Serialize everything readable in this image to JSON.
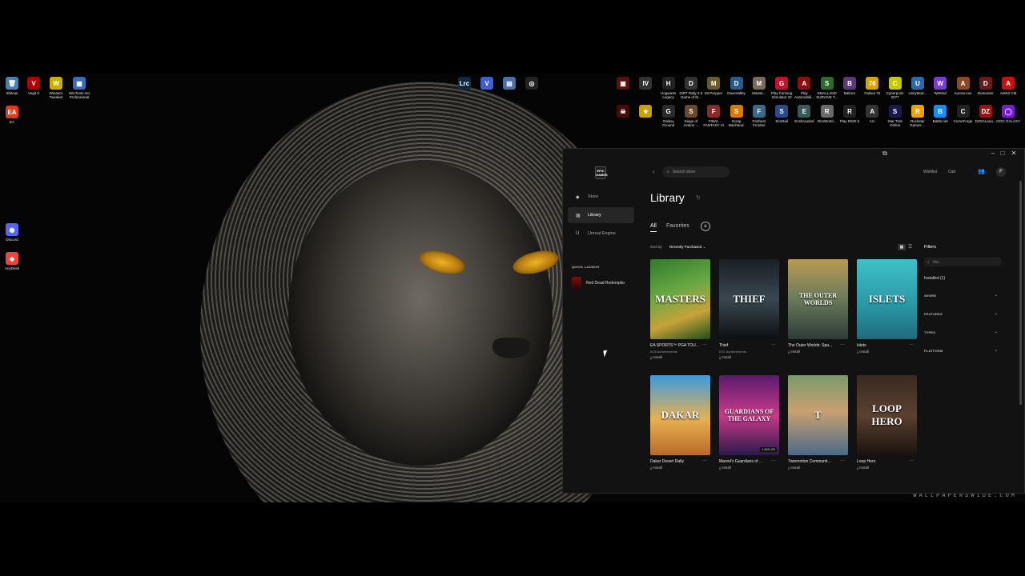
{
  "desktop": {
    "icons_left": [
      {
        "label": "Shitcan",
        "glyph": "🗑",
        "color": "#4a7fb5"
      },
      {
        "label": "Vegit 9",
        "glyph": "V",
        "color": "#b00000"
      },
      {
        "label": "Winaero Tweaker",
        "glyph": "W",
        "color": "#c9b000"
      },
      {
        "label": "WinTools.net Professional",
        "glyph": "▦",
        "color": "#3a6bb8"
      },
      {
        "label": "EA",
        "glyph": "EA",
        "color": "#e03a1e"
      },
      {
        "label": "Discord",
        "glyph": "◉",
        "color": "#5865f2"
      },
      {
        "label": "AnyDesk",
        "glyph": "◆",
        "color": "#ef443b"
      }
    ],
    "icons_top_center": [
      {
        "label": "",
        "glyph": "Lrc",
        "color": "#0d2a45"
      },
      {
        "label": "",
        "glyph": "V",
        "color": "#3f5fd0"
      },
      {
        "label": "",
        "glyph": "▤",
        "color": "#4b6ea8"
      },
      {
        "label": "",
        "glyph": "◎",
        "color": "#222"
      }
    ],
    "icons_top_right_row1": [
      {
        "label": "",
        "glyph": "▣",
        "color": "#5a1010"
      },
      {
        "label": "",
        "glyph": "IV",
        "color": "#333"
      },
      {
        "label": "Hogwarts Legacy",
        "glyph": "H",
        "color": "#222"
      },
      {
        "label": "DiRT Rally 2.0 Game of th...",
        "glyph": "D",
        "color": "#333"
      },
      {
        "label": "Mr.Prepper",
        "glyph": "M",
        "color": "#6a5a2a"
      },
      {
        "label": "DaveValley",
        "glyph": "D",
        "color": "#2a5a8a"
      },
      {
        "label": "Mansti...",
        "glyph": "M",
        "color": "#7a6a5a"
      },
      {
        "label": "Play Farming Simulator 22",
        "glyph": "G",
        "color": "#c8102e"
      },
      {
        "label": "Play Automobili...",
        "glyph": "A",
        "color": "#8a1010"
      },
      {
        "label": "SMALLAND SURVIVE T...",
        "glyph": "S",
        "color": "#2e6a2e"
      },
      {
        "label": "Balrum",
        "glyph": "B",
        "color": "#5a3a7a"
      },
      {
        "label": "Fallout 76",
        "glyph": "76",
        "color": "#d8a400"
      },
      {
        "label": "Cyberpunk 2077",
        "glyph": "C",
        "color": "#c8c800"
      },
      {
        "label": "UnityMod...",
        "glyph": "U",
        "color": "#2a6aa8"
      },
      {
        "label": "WeMod",
        "glyph": "W",
        "color": "#7a3ad8"
      },
      {
        "label": "Aurora.exe",
        "glyph": "A",
        "color": "#8a4a2a"
      },
      {
        "label": "Demonter",
        "glyph": "D",
        "color": "#6a1a1a"
      },
      {
        "label": "AMS2 CM",
        "glyph": "A",
        "color": "#c81010"
      }
    ],
    "icons_top_right_row2": [
      {
        "label": "",
        "glyph": "☠",
        "color": "#4a0a0a"
      },
      {
        "label": "",
        "glyph": "★",
        "color": "#c8a000"
      },
      {
        "label": "Galaxy Ground",
        "glyph": "G",
        "color": "#2a2a2a"
      },
      {
        "label": "Siege of Avalon ...",
        "glyph": "S",
        "color": "#6a4a2a"
      },
      {
        "label": "FINAL FANTASY VI",
        "glyph": "F",
        "color": "#8a2a2a"
      },
      {
        "label": "Scrap Mechanic",
        "glyph": "S",
        "color": "#d87a00"
      },
      {
        "label": "Farthest Frontier",
        "glyph": "F",
        "color": "#3a6a8a"
      },
      {
        "label": "SimRail",
        "glyph": "S",
        "color": "#2a4a8a"
      },
      {
        "label": "Enshrouded",
        "glyph": "E",
        "color": "#3a5a5a"
      },
      {
        "label": "RimWorld...",
        "glyph": "R",
        "color": "#6a6a6a"
      },
      {
        "label": "Play RIDE 5",
        "glyph": "R",
        "color": "#222"
      },
      {
        "label": "Arc",
        "glyph": "A",
        "color": "#333"
      },
      {
        "label": "Star Trek Online",
        "glyph": "S",
        "color": "#1a1a4a"
      },
      {
        "label": "Rockstar Games ...",
        "glyph": "R",
        "color": "#f0a000"
      },
      {
        "label": "Battle.net",
        "glyph": "B",
        "color": "#148eff"
      },
      {
        "label": "CurseForge",
        "glyph": "C",
        "color": "#222"
      },
      {
        "label": "DZSALaun...",
        "glyph": "DZ",
        "color": "#a01010"
      },
      {
        "label": "GOG GALAXY",
        "glyph": "◯",
        "color": "#7a1ad8"
      }
    ],
    "wallpaper_watermark": "WALLPAPERSWIDE.COM"
  },
  "window": {
    "buttons": {
      "minimize": "–",
      "maximize": "□",
      "close": "✕",
      "overlay": "⧉"
    }
  },
  "sidebar": {
    "logo_text": "EPIC GAMES",
    "items": [
      {
        "label": "Store",
        "icon": "tag-icon",
        "glyph": "◆"
      },
      {
        "label": "Library",
        "icon": "grid-icon",
        "glyph": "▦"
      },
      {
        "label": "Unreal Engine",
        "icon": "unreal-icon",
        "glyph": "U"
      }
    ],
    "quick_launch_heading": "QUICK LAUNCH",
    "quick_launch_item": "Red Dead Redemptio"
  },
  "header": {
    "back": "‹",
    "search_placeholder": "Search store",
    "wishlist": "Wishlist",
    "cart": "Cart",
    "avatar_initial": "F"
  },
  "library": {
    "title": "Library",
    "tabs": {
      "all": "All",
      "favorites": "Favorites",
      "add": "+"
    },
    "sort_label": "Sort by:",
    "sort_value": "Recently Purchased ⌄",
    "games": [
      {
        "title": "EA SPORTS™ PGA TOU...",
        "meta": "0/16 Achievements",
        "action": "Install",
        "art_text": "MASTERS",
        "bg": "linear-gradient(160deg,#2f7a2a 0%,#6aa844 40%,#c7a23a 70%,#1f4e1a 100%)",
        "badge": ""
      },
      {
        "title": "Thief",
        "meta": "0/37 Achievements",
        "action": "Install",
        "art_text": "THIEF",
        "bg": "linear-gradient(180deg,#1a1f24 0%,#3a4750 50%,#0d1013 100%)",
        "badge": ""
      },
      {
        "title": "The Outer Worlds: Spa...",
        "meta": "",
        "action": "Install",
        "art_text": "THE OUTER WORLDS",
        "bg": "linear-gradient(180deg,#b79a55 0%,#6a7a5a 50%,#2e3a3a 100%)",
        "badge": ""
      },
      {
        "title": "Islets",
        "meta": "",
        "action": "Install",
        "art_text": "ISLETS",
        "bg": "linear-gradient(180deg,#3fc0c8 0%,#2a9aa8 55%,#1f6a7a 100%)",
        "badge": ""
      },
      {
        "title": "Dakar Desert Rally",
        "meta": "",
        "action": "Install",
        "art_text": "DAKAR",
        "bg": "linear-gradient(180deg,#3a9ae0 0%,#e8b050 55%,#b86a2a 100%)",
        "badge": ""
      },
      {
        "title": "Marvel's Guardians of ...",
        "meta": "",
        "action": "Install",
        "art_text": "GUARDIANS OF THE GALAXY",
        "bg": "linear-gradient(180deg,#5a1a6a 0%,#c83a8a 50%,#2a1a4a 100%)",
        "badge": "1 ADD-ON"
      },
      {
        "title": "Twinmotion Communit...",
        "meta": "",
        "action": "Install",
        "art_text": "T",
        "bg": "linear-gradient(180deg,#7a9a6a 0%,#c8a070 45%,#4a6a8a 100%)",
        "badge": ""
      },
      {
        "title": "Loop Hero",
        "meta": "",
        "action": "Install",
        "art_text": "LOOP HERO",
        "bg": "linear-gradient(180deg,#3a2a20 0%,#5a4030 50%,#1a120e 100%)",
        "badge": ""
      }
    ]
  },
  "filters": {
    "heading": "Filters",
    "search_placeholder": "Title",
    "installed": "Installed (1)",
    "facets": [
      "GENRE",
      "FEATURES",
      "TYPES",
      "PLATFORM"
    ]
  },
  "colors": {
    "accent": "#ffffff",
    "window_bg": "#121212",
    "sidebar_active": "#262626"
  }
}
